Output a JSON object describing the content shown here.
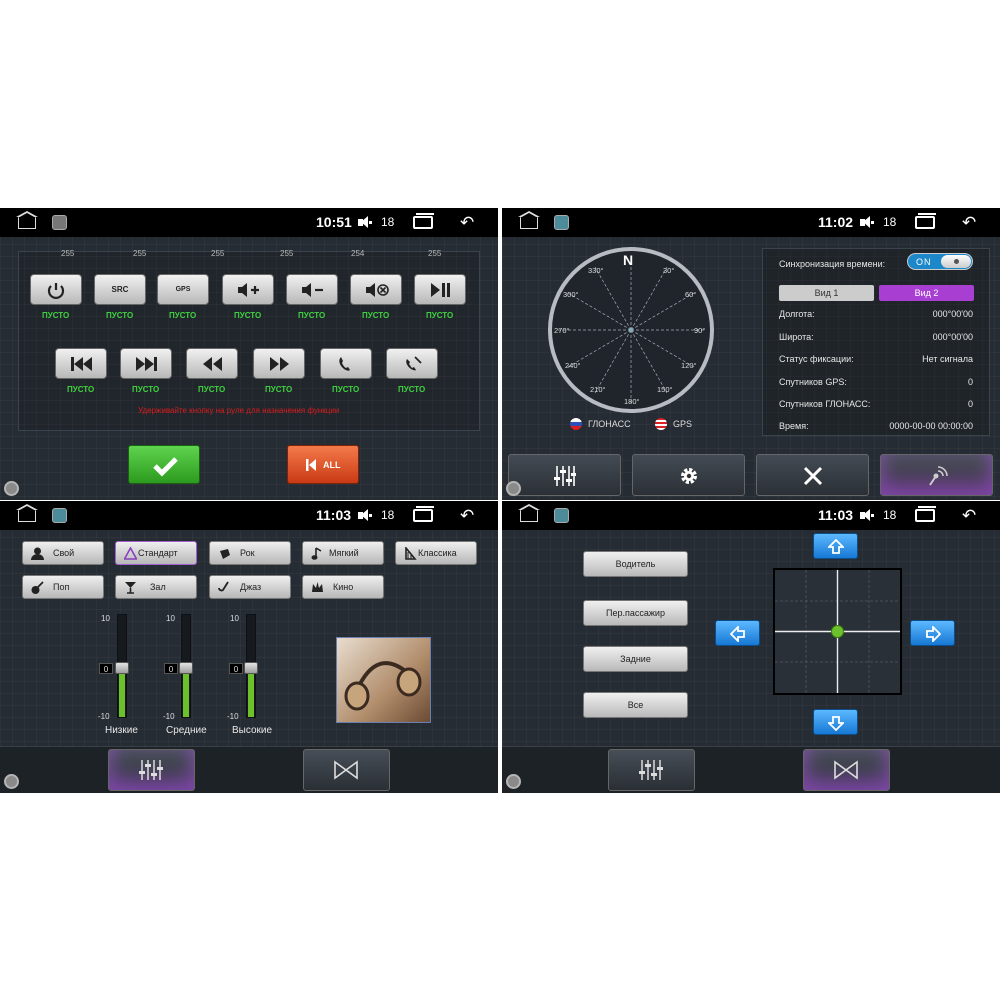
{
  "colors": {
    "accent_purple": "#a93fd2",
    "label_green": "#3fd13f",
    "hint_red": "#d81c1c",
    "ok_green": "#3fb02e",
    "all_orange": "#e55a28",
    "arrow_blue": "#2a8ee8",
    "toggle_blue": "#1c87c9",
    "eq_green": "#6cc02c"
  },
  "panel1": {
    "status": {
      "time": "10:51",
      "volume": "18"
    },
    "keys_row1": [
      {
        "num": "255",
        "icon": "power-icon",
        "label": "ПУСТО"
      },
      {
        "num": "255",
        "icon": "src-icon",
        "text": "SRC",
        "label": "ПУСТО"
      },
      {
        "num": "255",
        "icon": "gps-icon",
        "text": "GPS",
        "label": "ПУСТО"
      },
      {
        "num": "255",
        "icon": "volume-up-icon",
        "label": "ПУСТО"
      },
      {
        "num": "254",
        "icon": "volume-down-icon",
        "label": "ПУСТО"
      },
      {
        "num": "255",
        "icon": "mute-icon",
        "label": "ПУСТО"
      },
      {
        "num": "",
        "icon": "play-pause-icon",
        "label": "ПУСТО"
      }
    ],
    "keys_row2": [
      {
        "icon": "skip-previous-icon",
        "label": "ПУСТО"
      },
      {
        "icon": "skip-next-icon",
        "label": "ПУСТО"
      },
      {
        "icon": "rewind-icon",
        "label": "ПУСТО"
      },
      {
        "icon": "fast-forward-icon",
        "label": "ПУСТО"
      },
      {
        "icon": "phone-answer-icon",
        "label": "ПУСТО"
      },
      {
        "icon": "phone-hangup-icon",
        "label": "ПУСТО"
      }
    ],
    "hint": "Удерживайте кнопку на руле для назначения функции",
    "all_label": "ALL"
  },
  "panel2": {
    "status": {
      "time": "11:02",
      "volume": "18"
    },
    "compass": {
      "north": "N",
      "degrees": [
        "30°",
        "60°",
        "90°",
        "120°",
        "150°",
        "180°",
        "210°",
        "240°",
        "270°",
        "300°",
        "330°"
      ]
    },
    "legend": {
      "glonass": "ГЛОНАСС",
      "gps": "GPS"
    },
    "sync_label": "Синхронизация времени:",
    "toggle": "ON",
    "view1": "Вид 1",
    "view2": "Вид 2",
    "rows": [
      {
        "label": "Долгота:",
        "value": "000°00'00"
      },
      {
        "label": "Широта:",
        "value": "000°00'00"
      },
      {
        "label": "Статус фиксации:",
        "value": "Нет сигнала"
      },
      {
        "label": "Спутников GPS:",
        "value": "0"
      },
      {
        "label": "Спутников ГЛОНАСС:",
        "value": "0"
      },
      {
        "label": "Время:",
        "value": "0000-00-00 00:00:00"
      }
    ],
    "tabs": [
      "equalizer-icon",
      "gear-icon",
      "tools-icon",
      "gps-signal-icon"
    ]
  },
  "panel3": {
    "status": {
      "time": "11:03",
      "volume": "18"
    },
    "presets": [
      {
        "label": "Свой",
        "icon": "user-icon"
      },
      {
        "label": "Стандарт",
        "icon": "triangle-icon"
      },
      {
        "label": "Рок",
        "icon": "rock-icon"
      },
      {
        "label": "Мягкий",
        "icon": "note-icon"
      },
      {
        "label": "Классика",
        "icon": "harp-icon"
      },
      {
        "label": "Поп",
        "icon": "guitar-icon"
      },
      {
        "label": "Зал",
        "icon": "glass-icon"
      },
      {
        "label": "Джаз",
        "icon": "sax-icon"
      },
      {
        "label": "Кино",
        "icon": "crown-icon"
      }
    ],
    "bands": [
      {
        "label": "Низкие",
        "top": "10",
        "bottom": "-10",
        "value": "0"
      },
      {
        "label": "Средние",
        "top": "10",
        "bottom": "-10",
        "value": "0"
      },
      {
        "label": "Высокие",
        "top": "10",
        "bottom": "-10",
        "value": "0"
      }
    ]
  },
  "panel4": {
    "status": {
      "time": "11:03",
      "volume": "18"
    },
    "seats": [
      "Водитель",
      "Пер.пассажир",
      "Задние",
      "Все"
    ]
  }
}
